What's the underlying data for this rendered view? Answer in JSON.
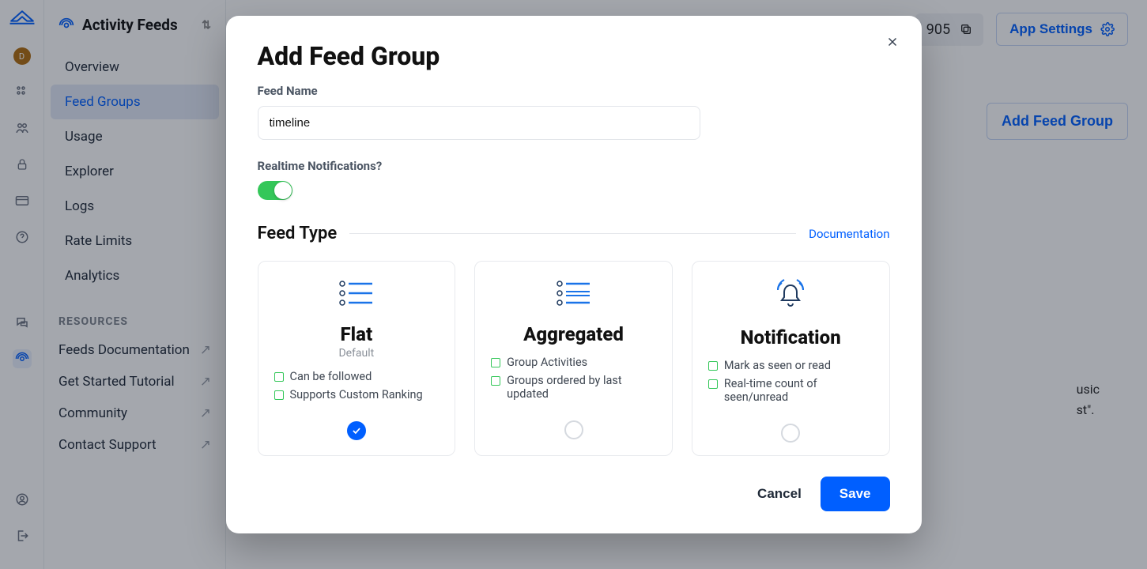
{
  "sidebar": {
    "section": "Activity Feeds",
    "avatar_initial": "D",
    "nav": [
      "Overview",
      "Feed Groups",
      "Usage",
      "Explorer",
      "Logs",
      "Rate Limits",
      "Analytics"
    ],
    "active_nav": "Feed Groups",
    "resources_label": "RESOURCES",
    "resources": [
      "Feeds Documentation",
      "Get Started Tutorial",
      "Community",
      "Contact Support"
    ]
  },
  "topbar": {
    "pill_text": "905",
    "app_settings": "App Settings"
  },
  "main_bg": {
    "add_btn": "Add Feed Group",
    "blurb_lines": [
      "usic",
      "st\"."
    ]
  },
  "modal": {
    "title": "Add Feed Group",
    "feed_name_label": "Feed Name",
    "feed_name_value": "timeline",
    "realtime_label": "Realtime Notifications?",
    "realtime_on": true,
    "feed_type_label": "Feed Type",
    "doc_link": "Documentation",
    "cards": [
      {
        "title": "Flat",
        "subtitle": "Default",
        "features": [
          "Can be followed",
          "Supports Custom Ranking"
        ],
        "selected": true
      },
      {
        "title": "Aggregated",
        "subtitle": "",
        "features": [
          "Group Activities",
          "Groups ordered by last updated"
        ],
        "selected": false
      },
      {
        "title": "Notification",
        "subtitle": "",
        "features": [
          "Mark as seen or read",
          "Real-time count of seen/unread"
        ],
        "selected": false
      }
    ],
    "cancel": "Cancel",
    "save": "Save"
  }
}
